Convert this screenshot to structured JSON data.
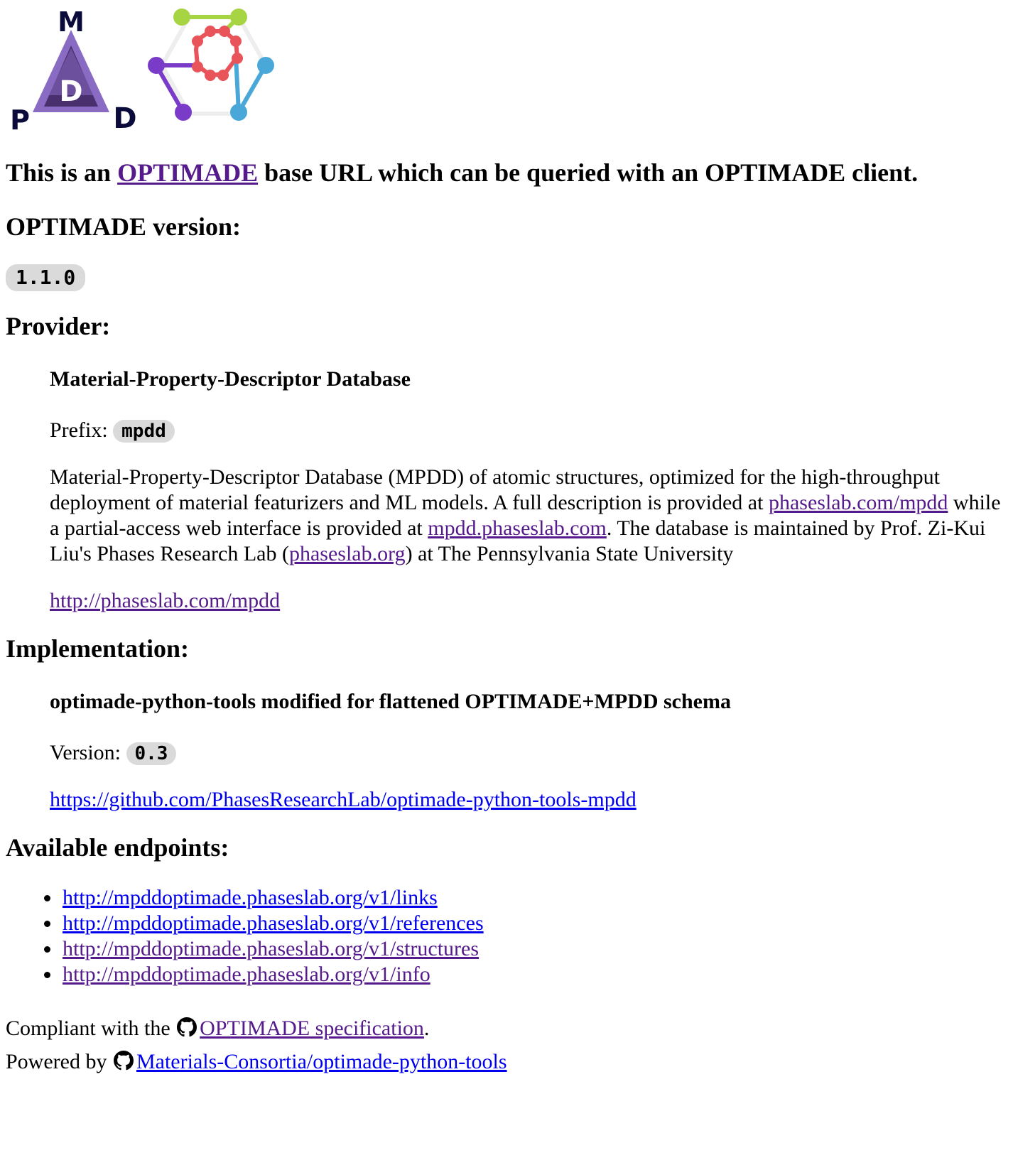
{
  "logos": {
    "mpdd_alt": "MPDD logo",
    "optimade_alt": "OPTIMADE logo",
    "mpdd_letters": [
      "M",
      "D",
      "P",
      "D"
    ]
  },
  "intro": {
    "prefix": "This is an ",
    "link_text": "OPTIMADE",
    "suffix": " base URL which can be queried with an OPTIMADE client."
  },
  "version_section": {
    "heading": "OPTIMADE version:",
    "version": "1.1.0"
  },
  "provider": {
    "heading": "Provider:",
    "name": "Material-Property-Descriptor Database",
    "prefix_label": "Prefix: ",
    "prefix_value": "mpdd",
    "description_parts": {
      "p1": "Material-Property-Descriptor Database (MPDD) of atomic structures, optimized for the high-throughput deployment of material featurizers and ML models. A full description is provided at ",
      "link1": "phaseslab.com/mpdd",
      "p2": " while a partial-access web interface is provided at ",
      "link2": "mpdd.phaseslab.com",
      "p3": ". The database is maintained by Prof. Zi-Kui Liu's Phases Research Lab (",
      "link3": "phaseslab.org",
      "p4": ") at The Pennsylvania State University"
    },
    "homepage": "http://phaseslab.com/mpdd"
  },
  "implementation": {
    "heading": "Implementation:",
    "name": "optimade-python-tools modified for flattened OPTIMADE+MPDD schema",
    "version_label": "Version: ",
    "version_value": "0.3",
    "source_url": "https://github.com/PhasesResearchLab/optimade-python-tools-mpdd"
  },
  "endpoints": {
    "heading": "Available endpoints:",
    "items": [
      "http://mpddoptimade.phaseslab.org/v1/links",
      "http://mpddoptimade.phaseslab.org/v1/references",
      "http://mpddoptimade.phaseslab.org/v1/structures",
      "http://mpddoptimade.phaseslab.org/v1/info"
    ]
  },
  "footer": {
    "compliant_prefix": "Compliant with the ",
    "spec_link": "OPTIMADE specification",
    "compliant_suffix": ".",
    "powered_prefix": "Powered by ",
    "tools_link": "Materials-Consortia/optimade-python-tools"
  },
  "colors": {
    "visited_link": "#551a8b",
    "unvisited_link": "#0000ee",
    "badge_bg": "#dadada",
    "mpdd_dark": "#4a2f6e",
    "mpdd_light": "#8a6bc4",
    "mpdd_letters": "#0b0b3b",
    "optimade_red": "#e8545a",
    "optimade_green": "#a6d443",
    "optimade_blue": "#4aa8d8",
    "optimade_purple": "#7a3cc8"
  },
  "icons": {
    "github": "github-icon"
  }
}
